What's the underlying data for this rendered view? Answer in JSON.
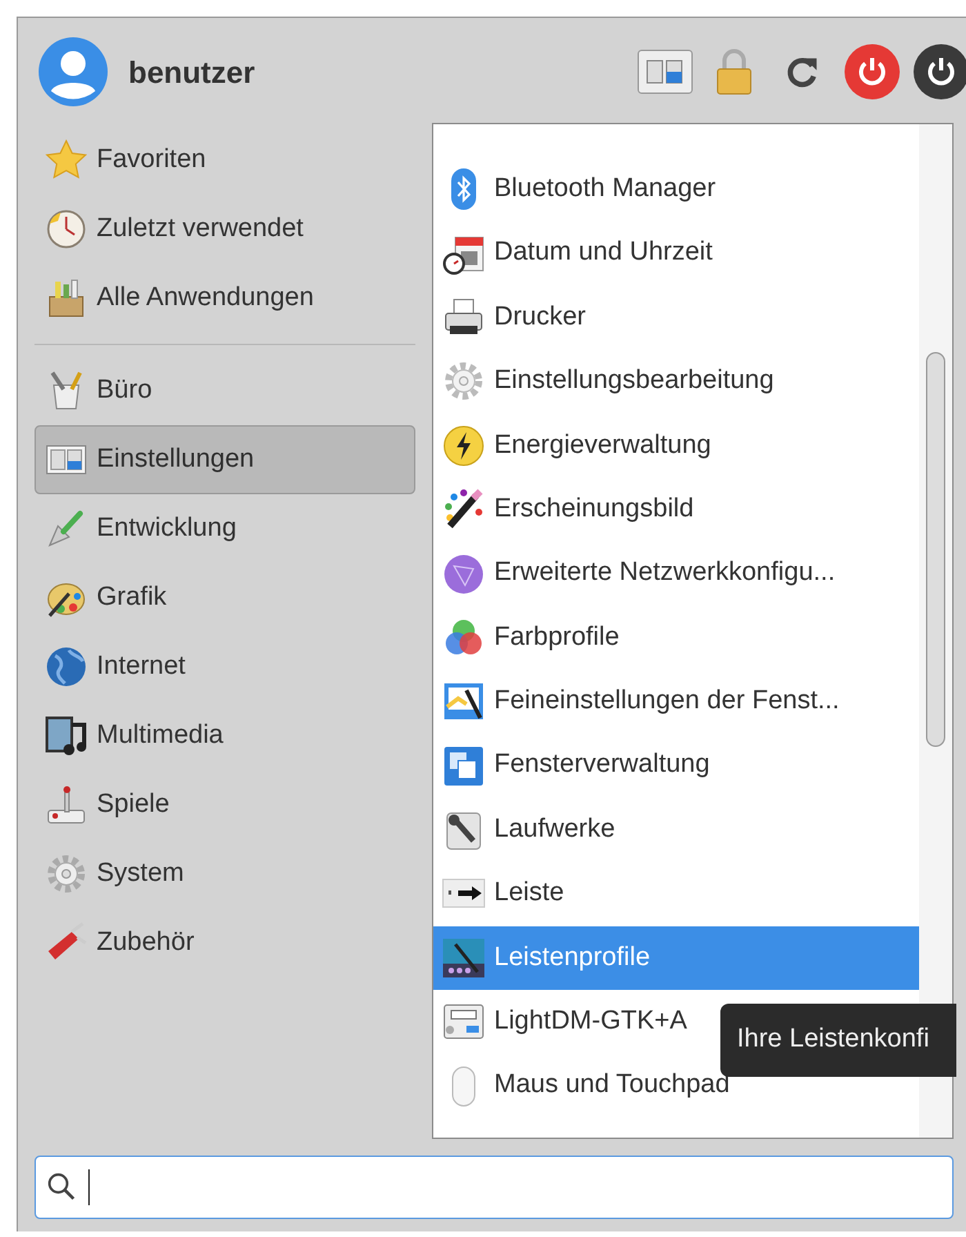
{
  "user": {
    "name": "benutzer"
  },
  "places": [
    {
      "label": "Favoriten",
      "selected": false
    },
    {
      "label": "Zuletzt verwendet",
      "selected": false
    },
    {
      "label": "Alle Anwendungen",
      "selected": false
    }
  ],
  "categories": [
    {
      "label": "Büro",
      "selected": false
    },
    {
      "label": "Einstellungen",
      "selected": true
    },
    {
      "label": "Entwicklung",
      "selected": false
    },
    {
      "label": "Grafik",
      "selected": false
    },
    {
      "label": "Internet",
      "selected": false
    },
    {
      "label": "Multimedia",
      "selected": false
    },
    {
      "label": "Spiele",
      "selected": false
    },
    {
      "label": "System",
      "selected": false
    },
    {
      "label": "Zubehör",
      "selected": false
    }
  ],
  "apps": [
    {
      "label": "Bluetooth Manager",
      "selected": false
    },
    {
      "label": "Datum und Uhrzeit",
      "selected": false
    },
    {
      "label": "Drucker",
      "selected": false
    },
    {
      "label": "Einstellungsbearbeitung",
      "selected": false
    },
    {
      "label": "Energieverwaltung",
      "selected": false
    },
    {
      "label": "Erscheinungsbild",
      "selected": false
    },
    {
      "label": "Erweiterte Netzwerkkonfigu...",
      "selected": false
    },
    {
      "label": "Farbprofile",
      "selected": false
    },
    {
      "label": "Feineinstellungen der Fenst...",
      "selected": false
    },
    {
      "label": "Fensterverwaltung",
      "selected": false
    },
    {
      "label": "Laufwerke",
      "selected": false
    },
    {
      "label": "Leiste",
      "selected": false
    },
    {
      "label": "Leistenprofile",
      "selected": true
    },
    {
      "label": "LightDM-GTK+A",
      "selected": false
    },
    {
      "label": "Maus und Touchpad",
      "selected": false
    }
  ],
  "tooltip": {
    "text": "Ihre Leistenkonfi"
  }
}
